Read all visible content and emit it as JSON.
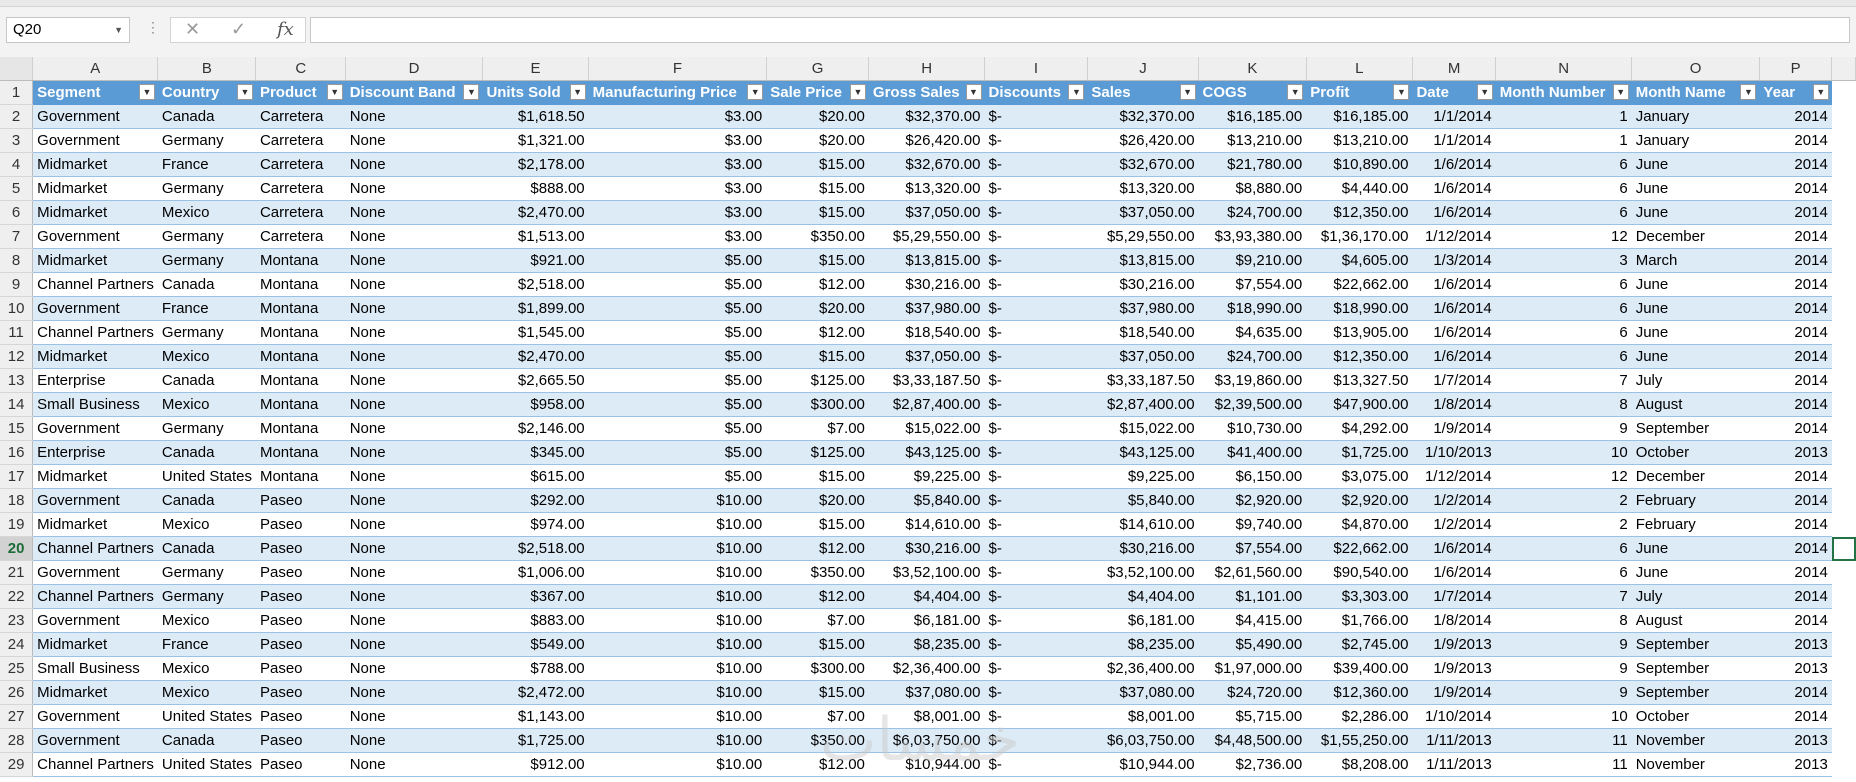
{
  "formula_bar": {
    "name_box": "Q20",
    "cancel_icon": "✕",
    "enter_icon": "✓",
    "fx_label": "fx",
    "formula": ""
  },
  "columns": [
    "A",
    "B",
    "C",
    "D",
    "E",
    "F",
    "G",
    "H",
    "I",
    "J",
    "K",
    "L",
    "M",
    "N",
    "O",
    "P"
  ],
  "headers": [
    "Segment",
    "Country",
    "Product",
    "Discount Band",
    "Units Sold",
    "Manufacturing Price",
    "Sale Price",
    "Gross Sales",
    "Discounts",
    "Sales",
    "COGS",
    "Profit",
    "Date",
    "Month Number",
    "Month Name",
    "Year"
  ],
  "row_numbers": [
    "1",
    "2",
    "3",
    "4",
    "5",
    "6",
    "7",
    "8",
    "9",
    "10",
    "11",
    "12",
    "13",
    "14",
    "15",
    "16",
    "17",
    "18",
    "19",
    "20",
    "21",
    "22",
    "23",
    "24",
    "25",
    "26",
    "27",
    "28",
    "29"
  ],
  "active_row": "20",
  "rows": [
    [
      "Government",
      "Canada",
      "Carretera",
      "None",
      "$1,618.50",
      "$3.00",
      "$20.00",
      "$32,370.00",
      "$-",
      "$32,370.00",
      "$16,185.00",
      "$16,185.00",
      "1/1/2014",
      "1",
      "January",
      "2014"
    ],
    [
      "Government",
      "Germany",
      "Carretera",
      "None",
      "$1,321.00",
      "$3.00",
      "$20.00",
      "$26,420.00",
      "$-",
      "$26,420.00",
      "$13,210.00",
      "$13,210.00",
      "1/1/2014",
      "1",
      "January",
      "2014"
    ],
    [
      "Midmarket",
      "France",
      "Carretera",
      "None",
      "$2,178.00",
      "$3.00",
      "$15.00",
      "$32,670.00",
      "$-",
      "$32,670.00",
      "$21,780.00",
      "$10,890.00",
      "1/6/2014",
      "6",
      "June",
      "2014"
    ],
    [
      "Midmarket",
      "Germany",
      "Carretera",
      "None",
      "$888.00",
      "$3.00",
      "$15.00",
      "$13,320.00",
      "$-",
      "$13,320.00",
      "$8,880.00",
      "$4,440.00",
      "1/6/2014",
      "6",
      "June",
      "2014"
    ],
    [
      "Midmarket",
      "Mexico",
      "Carretera",
      "None",
      "$2,470.00",
      "$3.00",
      "$15.00",
      "$37,050.00",
      "$-",
      "$37,050.00",
      "$24,700.00",
      "$12,350.00",
      "1/6/2014",
      "6",
      "June",
      "2014"
    ],
    [
      "Government",
      "Germany",
      "Carretera",
      "None",
      "$1,513.00",
      "$3.00",
      "$350.00",
      "$5,29,550.00",
      "$-",
      "$5,29,550.00",
      "$3,93,380.00",
      "$1,36,170.00",
      "1/12/2014",
      "12",
      "December",
      "2014"
    ],
    [
      "Midmarket",
      "Germany",
      "Montana",
      "None",
      "$921.00",
      "$5.00",
      "$15.00",
      "$13,815.00",
      "$-",
      "$13,815.00",
      "$9,210.00",
      "$4,605.00",
      "1/3/2014",
      "3",
      "March",
      "2014"
    ],
    [
      "Channel Partners",
      "Canada",
      "Montana",
      "None",
      "$2,518.00",
      "$5.00",
      "$12.00",
      "$30,216.00",
      "$-",
      "$30,216.00",
      "$7,554.00",
      "$22,662.00",
      "1/6/2014",
      "6",
      "June",
      "2014"
    ],
    [
      "Government",
      "France",
      "Montana",
      "None",
      "$1,899.00",
      "$5.00",
      "$20.00",
      "$37,980.00",
      "$-",
      "$37,980.00",
      "$18,990.00",
      "$18,990.00",
      "1/6/2014",
      "6",
      "June",
      "2014"
    ],
    [
      "Channel Partners",
      "Germany",
      "Montana",
      "None",
      "$1,545.00",
      "$5.00",
      "$12.00",
      "$18,540.00",
      "$-",
      "$18,540.00",
      "$4,635.00",
      "$13,905.00",
      "1/6/2014",
      "6",
      "June",
      "2014"
    ],
    [
      "Midmarket",
      "Mexico",
      "Montana",
      "None",
      "$2,470.00",
      "$5.00",
      "$15.00",
      "$37,050.00",
      "$-",
      "$37,050.00",
      "$24,700.00",
      "$12,350.00",
      "1/6/2014",
      "6",
      "June",
      "2014"
    ],
    [
      "Enterprise",
      "Canada",
      "Montana",
      "None",
      "$2,665.50",
      "$5.00",
      "$125.00",
      "$3,33,187.50",
      "$-",
      "$3,33,187.50",
      "$3,19,860.00",
      "$13,327.50",
      "1/7/2014",
      "7",
      "July",
      "2014"
    ],
    [
      "Small Business",
      "Mexico",
      "Montana",
      "None",
      "$958.00",
      "$5.00",
      "$300.00",
      "$2,87,400.00",
      "$-",
      "$2,87,400.00",
      "$2,39,500.00",
      "$47,900.00",
      "1/8/2014",
      "8",
      "August",
      "2014"
    ],
    [
      "Government",
      "Germany",
      "Montana",
      "None",
      "$2,146.00",
      "$5.00",
      "$7.00",
      "$15,022.00",
      "$-",
      "$15,022.00",
      "$10,730.00",
      "$4,292.00",
      "1/9/2014",
      "9",
      "September",
      "2014"
    ],
    [
      "Enterprise",
      "Canada",
      "Montana",
      "None",
      "$345.00",
      "$5.00",
      "$125.00",
      "$43,125.00",
      "$-",
      "$43,125.00",
      "$41,400.00",
      "$1,725.00",
      "1/10/2013",
      "10",
      "October",
      "2013"
    ],
    [
      "Midmarket",
      "United States",
      "Montana",
      "None",
      "$615.00",
      "$5.00",
      "$15.00",
      "$9,225.00",
      "$-",
      "$9,225.00",
      "$6,150.00",
      "$3,075.00",
      "1/12/2014",
      "12",
      "December",
      "2014"
    ],
    [
      "Government",
      "Canada",
      "Paseo",
      "None",
      "$292.00",
      "$10.00",
      "$20.00",
      "$5,840.00",
      "$-",
      "$5,840.00",
      "$2,920.00",
      "$2,920.00",
      "1/2/2014",
      "2",
      "February",
      "2014"
    ],
    [
      "Midmarket",
      "Mexico",
      "Paseo",
      "None",
      "$974.00",
      "$10.00",
      "$15.00",
      "$14,610.00",
      "$-",
      "$14,610.00",
      "$9,740.00",
      "$4,870.00",
      "1/2/2014",
      "2",
      "February",
      "2014"
    ],
    [
      "Channel Partners",
      "Canada",
      "Paseo",
      "None",
      "$2,518.00",
      "$10.00",
      "$12.00",
      "$30,216.00",
      "$-",
      "$30,216.00",
      "$7,554.00",
      "$22,662.00",
      "1/6/2014",
      "6",
      "June",
      "2014"
    ],
    [
      "Government",
      "Germany",
      "Paseo",
      "None",
      "$1,006.00",
      "$10.00",
      "$350.00",
      "$3,52,100.00",
      "$-",
      "$3,52,100.00",
      "$2,61,560.00",
      "$90,540.00",
      "1/6/2014",
      "6",
      "June",
      "2014"
    ],
    [
      "Channel Partners",
      "Germany",
      "Paseo",
      "None",
      "$367.00",
      "$10.00",
      "$12.00",
      "$4,404.00",
      "$-",
      "$4,404.00",
      "$1,101.00",
      "$3,303.00",
      "1/7/2014",
      "7",
      "July",
      "2014"
    ],
    [
      "Government",
      "Mexico",
      "Paseo",
      "None",
      "$883.00",
      "$10.00",
      "$7.00",
      "$6,181.00",
      "$-",
      "$6,181.00",
      "$4,415.00",
      "$1,766.00",
      "1/8/2014",
      "8",
      "August",
      "2014"
    ],
    [
      "Midmarket",
      "France",
      "Paseo",
      "None",
      "$549.00",
      "$10.00",
      "$15.00",
      "$8,235.00",
      "$-",
      "$8,235.00",
      "$5,490.00",
      "$2,745.00",
      "1/9/2013",
      "9",
      "September",
      "2013"
    ],
    [
      "Small Business",
      "Mexico",
      "Paseo",
      "None",
      "$788.00",
      "$10.00",
      "$300.00",
      "$2,36,400.00",
      "$-",
      "$2,36,400.00",
      "$1,97,000.00",
      "$39,400.00",
      "1/9/2013",
      "9",
      "September",
      "2013"
    ],
    [
      "Midmarket",
      "Mexico",
      "Paseo",
      "None",
      "$2,472.00",
      "$10.00",
      "$15.00",
      "$37,080.00",
      "$-",
      "$37,080.00",
      "$24,720.00",
      "$12,360.00",
      "1/9/2014",
      "9",
      "September",
      "2014"
    ],
    [
      "Government",
      "United States",
      "Paseo",
      "None",
      "$1,143.00",
      "$10.00",
      "$7.00",
      "$8,001.00",
      "$-",
      "$8,001.00",
      "$5,715.00",
      "$2,286.00",
      "1/10/2014",
      "10",
      "October",
      "2014"
    ],
    [
      "Government",
      "Canada",
      "Paseo",
      "None",
      "$1,725.00",
      "$10.00",
      "$350.00",
      "$6,03,750.00",
      "$-",
      "$6,03,750.00",
      "$4,48,500.00",
      "$1,55,250.00",
      "1/11/2013",
      "11",
      "November",
      "2013"
    ],
    [
      "Channel Partners",
      "United States",
      "Paseo",
      "None",
      "$912.00",
      "$10.00",
      "$12.00",
      "$10,944.00",
      "$-",
      "$10,944.00",
      "$2,736.00",
      "$8,208.00",
      "1/11/2013",
      "11",
      "November",
      "2013"
    ]
  ],
  "col_align": [
    "left",
    "left",
    "left",
    "left",
    "right",
    "right",
    "right",
    "right",
    "left",
    "right",
    "right",
    "right",
    "right",
    "right",
    "left",
    "right"
  ],
  "watermark": "خمسات"
}
